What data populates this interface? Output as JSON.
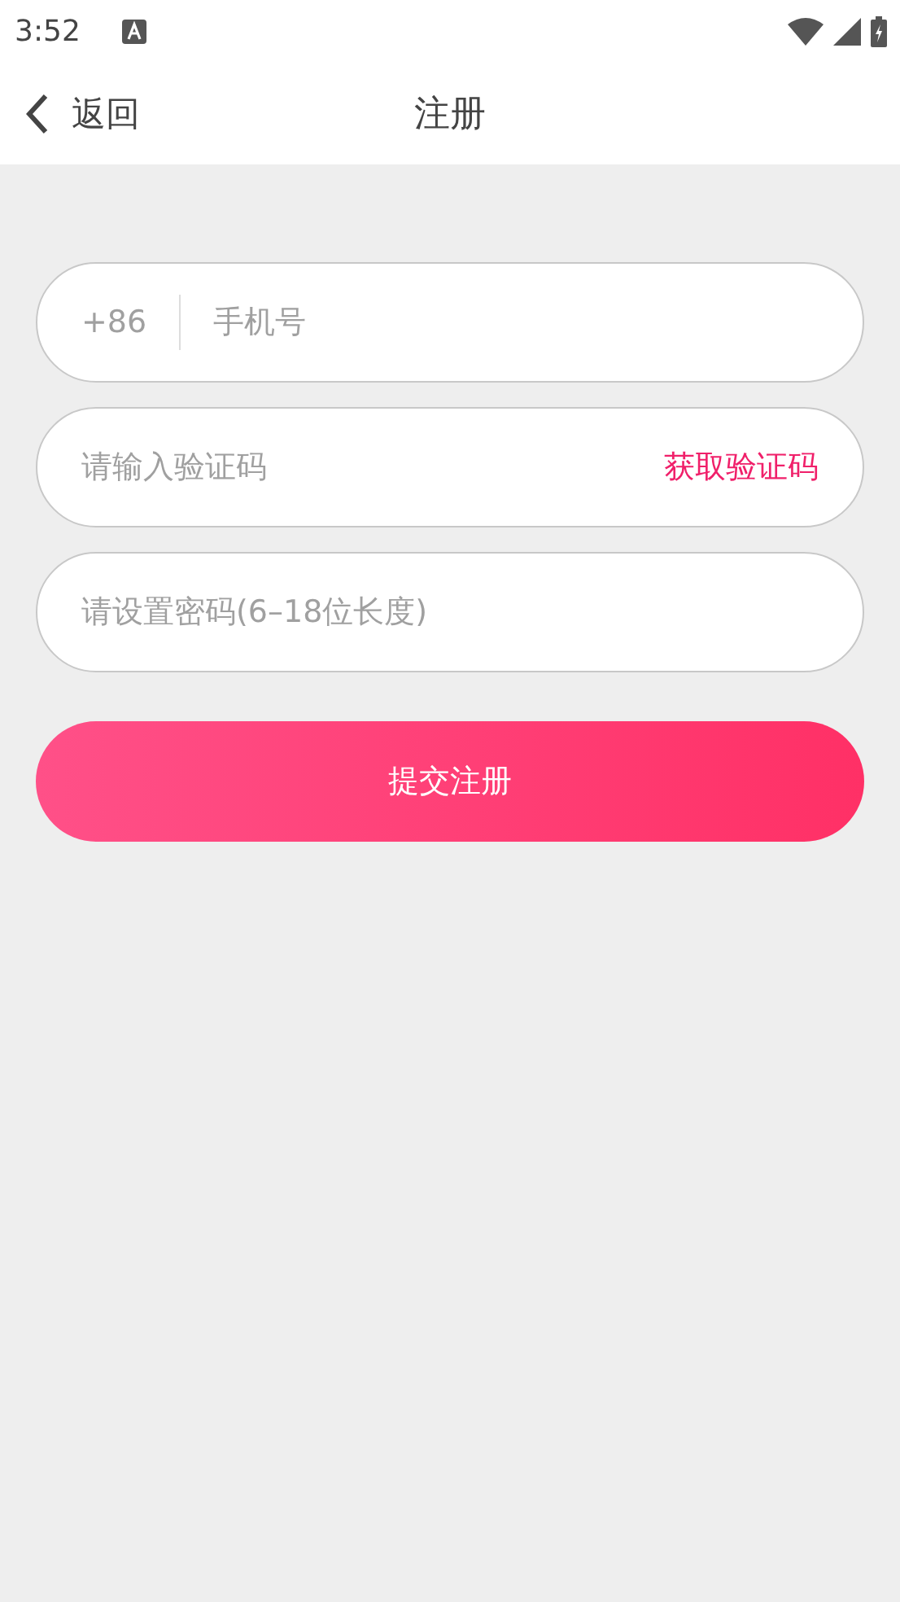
{
  "status_bar": {
    "time": "3:52"
  },
  "app_bar": {
    "back_label": "返回",
    "title": "注册"
  },
  "fields": [
    {
      "kind": "phone",
      "prefix": "+86",
      "placeholder": "手机号"
    },
    {
      "kind": "code",
      "placeholder": "请输入验证码",
      "action": "获取验证码"
    },
    {
      "kind": "password",
      "placeholder": "请设置密码(6–18位长度)"
    }
  ],
  "submit": {
    "label": "提交注册"
  }
}
